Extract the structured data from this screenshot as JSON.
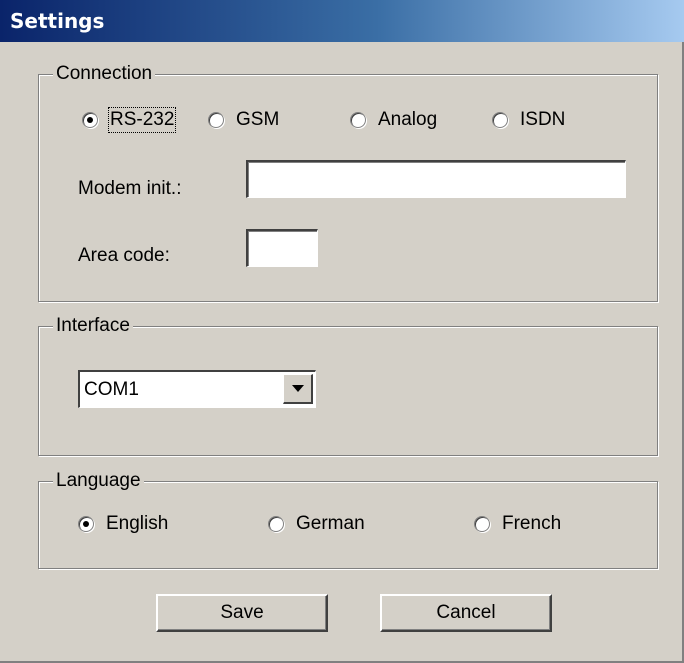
{
  "window": {
    "title": "Settings"
  },
  "connection": {
    "legend": "Connection",
    "options": [
      {
        "label": "RS-232",
        "checked": true
      },
      {
        "label": "GSM",
        "checked": false
      },
      {
        "label": "Analog",
        "checked": false
      },
      {
        "label": "ISDN",
        "checked": false
      }
    ],
    "modem_init_label": "Modem init.:",
    "modem_init_value": "",
    "area_code_label": "Area code:",
    "area_code_value": ""
  },
  "interface": {
    "legend": "Interface",
    "selected": "COM1"
  },
  "language": {
    "legend": "Language",
    "options": [
      {
        "label": "English",
        "checked": true
      },
      {
        "label": "German",
        "checked": false
      },
      {
        "label": "French",
        "checked": false
      }
    ]
  },
  "buttons": {
    "save": "Save",
    "cancel": "Cancel"
  }
}
